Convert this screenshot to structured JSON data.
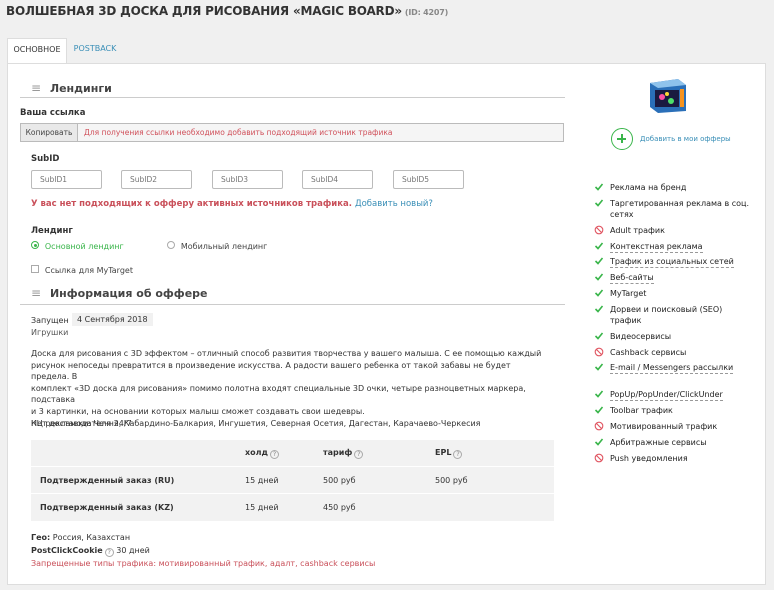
{
  "header": {
    "title": "ВОЛШЕБНАЯ 3D ДОСКА ДЛЯ РИСОВАНИЯ «MAGIC BOARD»",
    "id_text": "(ID: 4207)"
  },
  "tabs": [
    {
      "label": "ОСНОВНОЕ",
      "active": true
    },
    {
      "label": "POSTBACK",
      "active": false
    }
  ],
  "landings_section": {
    "title": "Лендинги",
    "your_link_label": "Ваша ссылка",
    "copy_button": "Копировать",
    "link_message": "Для получения ссылки необходимо добавить подходящий источник трафика",
    "subid_label": "SubID",
    "subid_placeholders": [
      "SubID1",
      "SubID2",
      "SubID3",
      "SubID4",
      "SubID5"
    ],
    "warning": "У вас нет подходящих к офферу активных источников трафика.",
    "add_new": "Добавить новый?",
    "landing_label": "Лендинг",
    "radio_main": "Основной лендинг",
    "radio_mobile": "Мобильный лендинг",
    "selected": "main",
    "mytarget_label": "Ссылка для MyTarget",
    "mytarget_checked": false
  },
  "offer_info": {
    "title": "Информация об оффере",
    "launched_label": "Запущен",
    "launched_date": "4 Сентября 2018",
    "category": "Игрушки",
    "description": [
      "Доска для рисования с 3D эффектом – отличный способ развития творчества у вашего малыша. С ее помощью каждый",
      "рисунок непоседы превратится в произведение искусства. А радости вашего ребенка от такой забавы не будет предела. В",
      "комплект «3D доска для рисования» помимо полотна входят специальные 3D очки, четыре разноцветных маркера, подставка",
      "и 3 картинки, на основании которых малыш сможет создавать свои шедевры.",
      "КЦ рекламодателя 24/7"
    ],
    "no_delivery": "Нет доставки: Чечня, Кабардино-Балкария, Ингушетия, Северная Осетия, Дагестан, Карачаево-Черкесия",
    "table": {
      "headers": [
        "холд",
        "тариф",
        "EPL"
      ],
      "rows": [
        {
          "name": "Подтвержденный заказ (RU)",
          "hold": "15 дней",
          "tariff": "500 руб",
          "epl": "500 руб"
        },
        {
          "name": "Подтвержденный заказ (KZ)",
          "hold": "15 дней",
          "tariff": "450 руб",
          "epl": ""
        }
      ]
    },
    "geo_label": "Гео:",
    "geo_value": "Россия, Казахстан",
    "pcc_label": "PostClickCookie",
    "pcc_value": "30 дней",
    "forbidden": "Запрещенные типы трафика: мотивированный трафик, адалт,  cashback сервисы"
  },
  "sidebar": {
    "add_to_offers": "Добавить в мои офферы",
    "colors": {
      "allowed": "#39b54a",
      "forbidden": "#e05561"
    },
    "traffic": [
      {
        "label": "Реклама на бренд",
        "allowed": true,
        "underline": false
      },
      {
        "label": "Таргетированная реклама в соц. сетях",
        "allowed": true,
        "underline": false
      },
      {
        "label": "Adult трафик",
        "allowed": false,
        "underline": false
      },
      {
        "label": "Контекстная реклама",
        "allowed": true,
        "underline": true
      },
      {
        "label": "Трафик из социальных сетей",
        "allowed": true,
        "underline": true
      },
      {
        "label": "Веб-сайты",
        "allowed": true,
        "underline": true
      },
      {
        "label": "MyTarget",
        "allowed": true,
        "underline": false
      },
      {
        "label": "Дорвеи и поисковый (SEO) трафик",
        "allowed": true,
        "underline": false
      },
      {
        "label": "Видеосервисы",
        "allowed": true,
        "underline": false
      },
      {
        "label": "Cashback сервисы",
        "allowed": false,
        "underline": false
      },
      {
        "label": "E-mail / Messengers рассылки",
        "allowed": true,
        "underline": true
      },
      {
        "label": "PopUp/PopUnder/ClickUnder",
        "allowed": true,
        "underline": true
      },
      {
        "label": "Toolbar трафик",
        "allowed": true,
        "underline": false
      },
      {
        "label": "Мотивированный трафик",
        "allowed": false,
        "underline": false
      },
      {
        "label": "Арбитражные сервисы",
        "allowed": true,
        "underline": false
      },
      {
        "label": "Push уведомления",
        "allowed": false,
        "underline": false
      }
    ]
  }
}
